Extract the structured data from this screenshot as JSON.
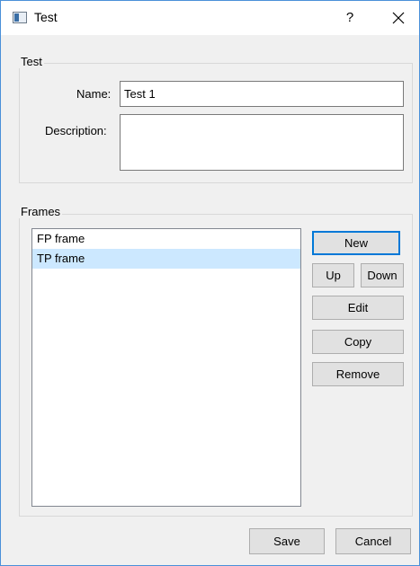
{
  "window": {
    "title": "Test",
    "help_glyph": "?",
    "icons": {
      "app": "window-icon",
      "close": "close-icon"
    }
  },
  "test_group": {
    "title": "Test",
    "name_label": "Name:",
    "name_value": "Test 1",
    "description_label": "Description:",
    "description_value": ""
  },
  "frames_group": {
    "title": "Frames",
    "items": [
      {
        "label": "FP frame",
        "selected": false
      },
      {
        "label": "TP frame",
        "selected": true
      }
    ],
    "buttons": {
      "new": "New",
      "up": "Up",
      "down": "Down",
      "edit": "Edit",
      "copy": "Copy",
      "remove": "Remove"
    }
  },
  "footer": {
    "save": "Save",
    "cancel": "Cancel"
  },
  "colors": {
    "selection": "#cce8ff",
    "accent": "#0078d7",
    "window_border": "#4a90d9"
  }
}
